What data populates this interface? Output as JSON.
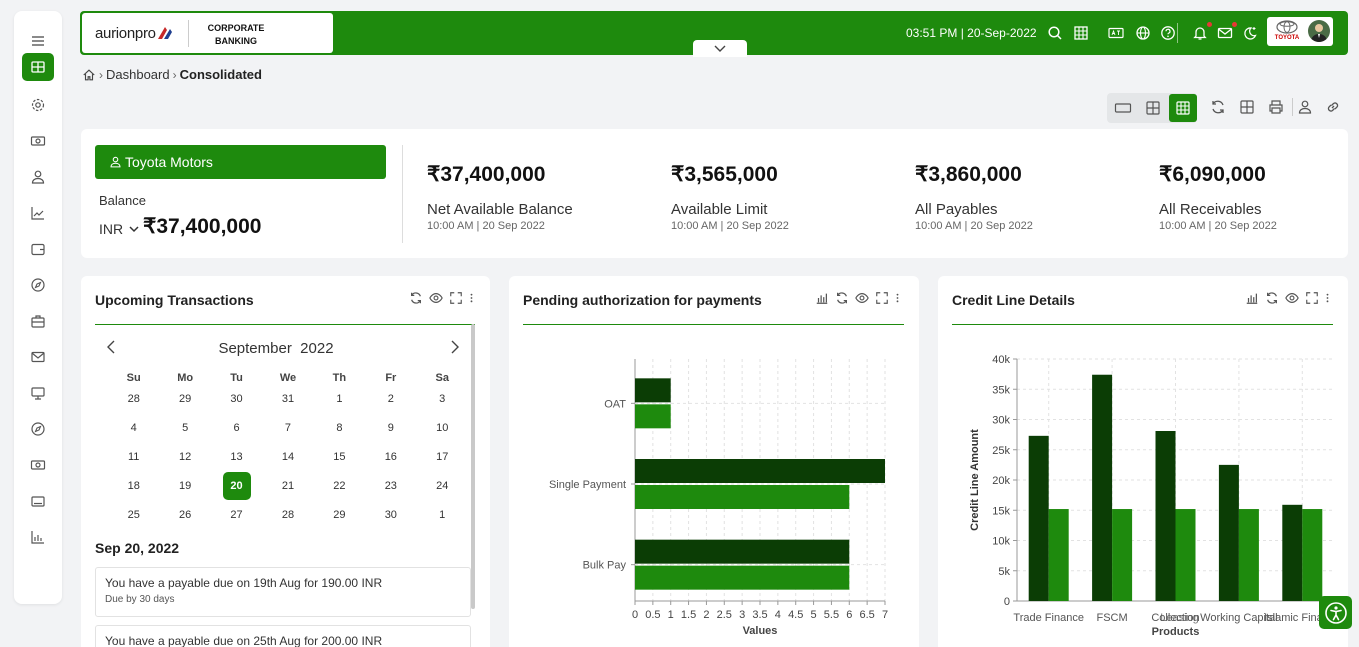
{
  "sidebar": {
    "icons": [
      "menu-icon",
      "dashboard-icon",
      "settings-icon",
      "payments-icon",
      "user-icon",
      "trending-icon",
      "wallet-icon",
      "explore-icon",
      "briefcase-icon",
      "mail-icon",
      "monitor-icon",
      "compass-icon",
      "cash-icon",
      "card-icon",
      "report-icon"
    ]
  },
  "header": {
    "logo_text": "aurionpro",
    "product": "CORPORATE BANKING",
    "datetime": "03:51 PM | 20-Sep-2022",
    "brand": "TOYOTA",
    "icons": [
      "search-icon",
      "grid-icon",
      "language-icon",
      "globe-icon",
      "help-icon",
      "bell-icon",
      "mail-icon",
      "theme-icon"
    ]
  },
  "breadcrumb": {
    "home": "home-icon",
    "parent": "Dashboard",
    "current": "Consolidated"
  },
  "summary": {
    "company": "Toyota Motors",
    "balance_label": "Balance",
    "currency": "INR",
    "balance": "₹37,400,000",
    "metrics": [
      {
        "amount": "₹37,400,000",
        "label": "Net Available Balance",
        "time": "10:00 AM | 20 Sep 2022"
      },
      {
        "amount": "₹3,565,000",
        "label": "Available Limit",
        "time": "10:00 AM | 20 Sep 2022"
      },
      {
        "amount": "₹3,860,000",
        "label": "All Payables",
        "time": "10:00 AM | 20 Sep 2022"
      },
      {
        "amount": "₹6,090,000",
        "label": "All Receivables",
        "time": "10:00 AM | 20 Sep 2022"
      }
    ]
  },
  "upcoming": {
    "title": "Upcoming Transactions",
    "month": "September",
    "year": "2022",
    "weekdays": [
      "Su",
      "Mo",
      "Tu",
      "We",
      "Th",
      "Fr",
      "Sa"
    ],
    "weeks": [
      [
        "28",
        "29",
        "30",
        "31",
        "1",
        "2",
        "3"
      ],
      [
        "4",
        "5",
        "6",
        "7",
        "8",
        "9",
        "10"
      ],
      [
        "11",
        "12",
        "13",
        "14",
        "15",
        "16",
        "17"
      ],
      [
        "18",
        "19",
        "20",
        "21",
        "22",
        "23",
        "24"
      ],
      [
        "25",
        "26",
        "27",
        "28",
        "29",
        "30",
        "1"
      ]
    ],
    "selected_day": "20",
    "date_heading": "Sep 20, 2022",
    "items": [
      {
        "text": "You have a payable due on 19th Aug for 190.00 INR",
        "sub": "Due by 30 days"
      },
      {
        "text": "You have a payable due on 25th Aug for 200.00 INR",
        "sub": ""
      }
    ]
  },
  "pending": {
    "title": "Pending authorization for payments"
  },
  "credit": {
    "title": "Credit Line Details"
  },
  "chart_data": [
    {
      "type": "bar",
      "orientation": "horizontal",
      "categories": [
        "OAT",
        "Single Payment",
        "Bulk Pay"
      ],
      "series": [
        {
          "color": "#0b3d05",
          "values": [
            1,
            7,
            6
          ]
        },
        {
          "color": "#1e8a0d",
          "values": [
            1,
            6,
            6
          ]
        }
      ],
      "xlabel": "Values",
      "xlim": [
        0,
        7
      ],
      "xticks": [
        "0",
        "0.5",
        "1",
        "1.5",
        "2",
        "2.5",
        "3",
        "3.5",
        "4",
        "4.5",
        "5",
        "5.5",
        "6",
        "6.5",
        "7"
      ],
      "grid": true
    },
    {
      "type": "bar",
      "categories": [
        "Trade Finance",
        "FSCM",
        "Collection",
        "Leasing",
        "Working Capital",
        "Islamic Finance"
      ],
      "tick_labels": [
        "Trade Finance",
        "FSCM",
        "Collection",
        "Working Capital",
        "Islamic Finance"
      ],
      "tick_overlap_label": "Leasing",
      "series": [
        {
          "color": "#0b3d05",
          "values": [
            27300,
            37400,
            28100,
            22500,
            15900
          ]
        },
        {
          "color": "#1e8a0d",
          "values": [
            15200,
            15200,
            15200,
            15200,
            15200
          ]
        }
      ],
      "xlabel": "Products",
      "ylabel": "Credit Line Amount",
      "ylim": [
        0,
        40000
      ],
      "yticks": [
        "0",
        "5k",
        "10k",
        "15k",
        "20k",
        "25k",
        "30k",
        "35k",
        "40k"
      ],
      "grid": true
    }
  ]
}
